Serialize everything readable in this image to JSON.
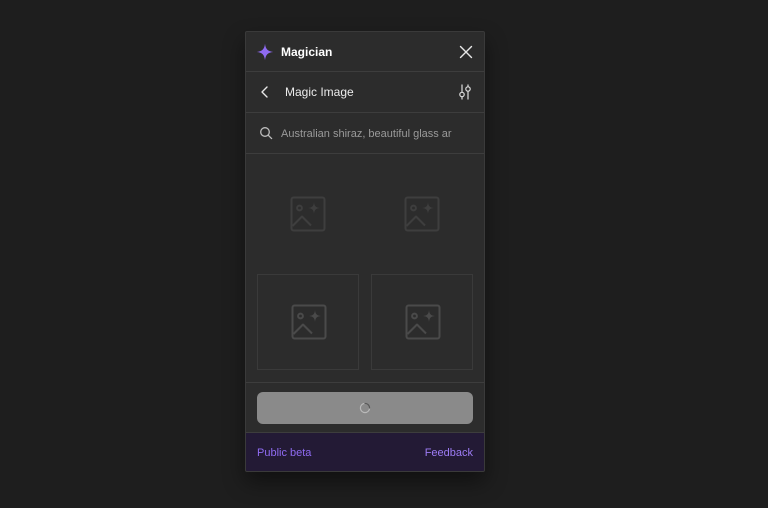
{
  "header": {
    "title": "Magician",
    "brand_icon": "sparkle-icon",
    "close_icon": "close-icon"
  },
  "subheader": {
    "title": "Magic Image",
    "back_icon": "chevron-left-icon",
    "settings_icon": "sliders-icon"
  },
  "search": {
    "value": "Australian shiraz, beautiful glass ar",
    "icon": "search-icon"
  },
  "grid": {
    "tile_icon": "image-placeholder-icon",
    "tiles": 4
  },
  "action": {
    "state": "loading",
    "icon": "spinner-icon"
  },
  "footer": {
    "beta_label": "Public beta",
    "feedback_label": "Feedback"
  },
  "colors": {
    "background": "#1e1e1e",
    "panel": "#2c2c2c",
    "accent": "#8f6bf2",
    "footer": "#231a35",
    "button": "#8a8a8a"
  }
}
